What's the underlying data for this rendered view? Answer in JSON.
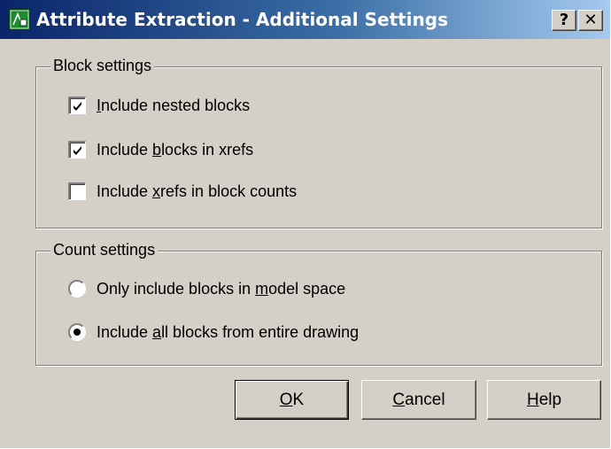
{
  "window": {
    "title": "Attribute Extraction - Additional Settings",
    "help_glyph": "?",
    "close_glyph": "✕",
    "icon": "attribute-extraction-icon"
  },
  "block_settings": {
    "label": "Block settings",
    "options": [
      {
        "pre": "",
        "key": "I",
        "post": "nclude nested blocks",
        "checked": true
      },
      {
        "pre": "Include ",
        "key": "b",
        "post": "locks in xrefs",
        "checked": true
      },
      {
        "pre": "Include ",
        "key": "x",
        "post": "refs in block counts",
        "checked": false
      }
    ]
  },
  "count_settings": {
    "label": "Count settings",
    "options": [
      {
        "pre": "Only include blocks in ",
        "key": "m",
        "post": "odel space",
        "selected": false
      },
      {
        "pre": "Include ",
        "key": "a",
        "post": "ll blocks from entire drawing",
        "selected": true
      }
    ]
  },
  "buttons": {
    "ok": {
      "key": "O",
      "post": "K"
    },
    "cancel": {
      "key": "C",
      "post": "ancel"
    },
    "help": {
      "key": "H",
      "post": "elp"
    }
  },
  "colors": {
    "title_start": "#0a246a",
    "title_end": "#a6caf0",
    "face": "#d4d0c8"
  }
}
